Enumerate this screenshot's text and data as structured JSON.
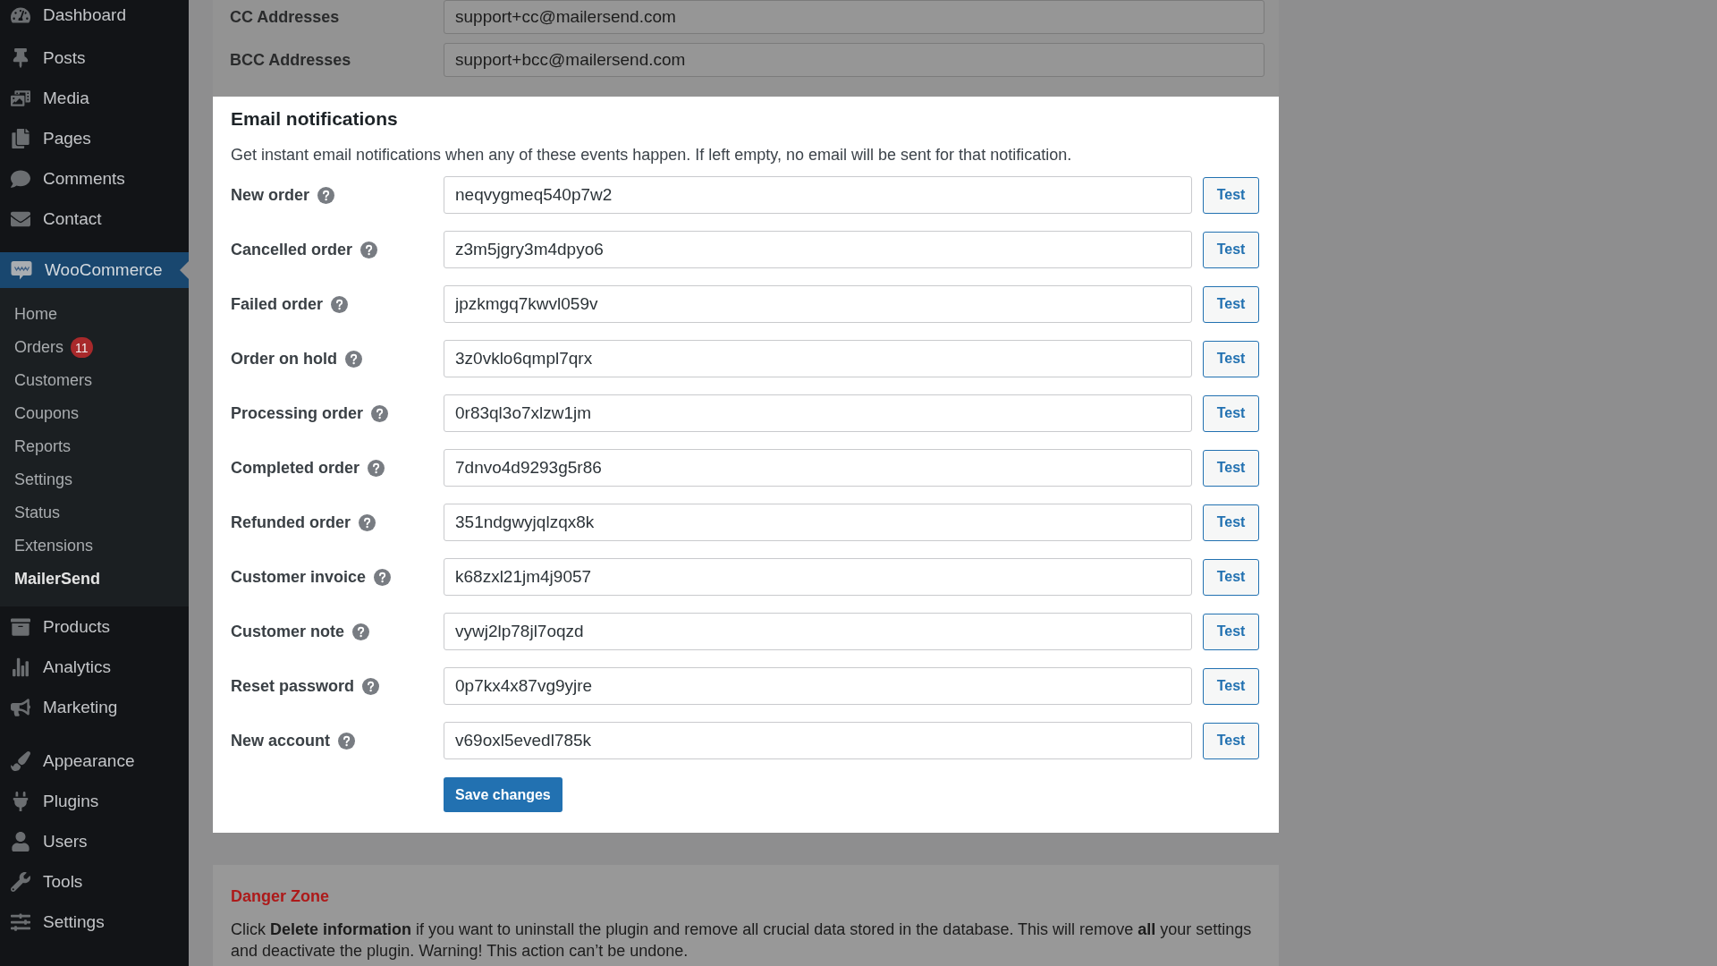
{
  "sidebar": {
    "groups": [
      {
        "items": [
          {
            "label": "Dashboard",
            "selected": false
          }
        ]
      },
      {
        "items": [
          {
            "label": "Posts",
            "selected": false
          },
          {
            "label": "Media",
            "selected": false
          },
          {
            "label": "Pages",
            "selected": false
          },
          {
            "label": "Comments",
            "selected": false
          },
          {
            "label": "Contact",
            "selected": false
          }
        ]
      },
      {
        "items": [
          {
            "label": "WooCommerce",
            "selected": true,
            "children": [
              {
                "label": "Home",
                "selected": false
              },
              {
                "label": "Orders",
                "badge": "11",
                "selected": false
              },
              {
                "label": "Customers",
                "selected": false
              },
              {
                "label": "Coupons",
                "selected": false
              },
              {
                "label": "Reports",
                "selected": false
              },
              {
                "label": "Settings",
                "selected": false
              },
              {
                "label": "Status",
                "selected": false
              },
              {
                "label": "Extensions",
                "selected": false
              },
              {
                "label": "MailerSend",
                "selected": true
              }
            ]
          },
          {
            "label": "Products",
            "selected": false
          },
          {
            "label": "Analytics",
            "selected": false
          },
          {
            "label": "Marketing",
            "selected": false
          }
        ]
      },
      {
        "items": [
          {
            "label": "Appearance",
            "selected": false
          },
          {
            "label": "Plugins",
            "selected": false
          },
          {
            "label": "Users",
            "selected": false
          },
          {
            "label": "Tools",
            "selected": false
          },
          {
            "label": "Settings",
            "selected": false
          }
        ]
      }
    ]
  },
  "recipients": {
    "fields": [
      {
        "label": "CC Addresses",
        "value": "support+cc@mailersend.com"
      },
      {
        "label": "BCC Addresses",
        "value": "support+bcc@mailersend.com"
      }
    ]
  },
  "email_notifications": {
    "title": "Email notifications",
    "description": "Get instant email notifications when any of these events happen. If left empty, no email will be sent for that notification.",
    "rows": [
      {
        "label": "New order",
        "value": "neqvygmeq540p7w2",
        "button": "Test"
      },
      {
        "label": "Cancelled order",
        "value": "z3m5jgry3m4dpyo6",
        "button": "Test"
      },
      {
        "label": "Failed order",
        "value": "jpzkmgq7kwvl059v",
        "button": "Test"
      },
      {
        "label": "Order on hold",
        "value": "3z0vklo6qmpl7qrx",
        "button": "Test"
      },
      {
        "label": "Processing order",
        "value": "0r83ql3o7xlzw1jm",
        "button": "Test"
      },
      {
        "label": "Completed order",
        "value": "7dnvo4d9293g5r86",
        "button": "Test"
      },
      {
        "label": "Refunded order",
        "value": "351ndgwyjqlzqx8k",
        "button": "Test"
      },
      {
        "label": "Customer invoice",
        "value": "k68zxl21jm4j9057",
        "button": "Test"
      },
      {
        "label": "Customer note",
        "value": "vywj2lp78jl7oqzd",
        "button": "Test"
      },
      {
        "label": "Reset password",
        "value": "0p7kx4x87vg9yjre",
        "button": "Test"
      },
      {
        "label": "New account",
        "value": "v69oxl5evedl785k",
        "button": "Test"
      }
    ],
    "save_button": "Save changes"
  },
  "danger_zone": {
    "title": "Danger Zone",
    "text": "Click **Delete information** if you want to uninstall the plugin and remove all crucial data stored in the database. This will remove **all** your settings and deactivate the plugin. Warning! This action can’t be undone."
  }
}
